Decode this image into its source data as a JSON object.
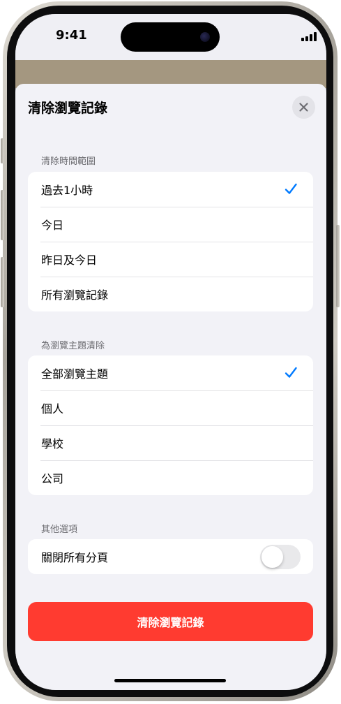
{
  "status_bar": {
    "time": "9:41",
    "battery_level": 0.85
  },
  "sheet": {
    "title": "清除瀏覽記錄",
    "close_icon": "close-icon"
  },
  "time_range": {
    "header": "清除時間範圍",
    "options": [
      {
        "label": "過去1小時",
        "selected": true
      },
      {
        "label": "今日",
        "selected": false
      },
      {
        "label": "昨日及今日",
        "selected": false
      },
      {
        "label": "所有瀏覽記錄",
        "selected": false
      }
    ]
  },
  "profiles": {
    "header": "為瀏覽主題清除",
    "options": [
      {
        "label": "全部瀏覽主題",
        "selected": true
      },
      {
        "label": "個人",
        "selected": false
      },
      {
        "label": "學校",
        "selected": false
      },
      {
        "label": "公司",
        "selected": false
      }
    ]
  },
  "other_options": {
    "header": "其他選項",
    "close_all_tabs": {
      "label": "關閉所有分頁",
      "on": false
    }
  },
  "action_button": {
    "label": "清除瀏覽記錄"
  },
  "colors": {
    "accent": "#007aff",
    "destructive": "#ff3b30",
    "sheet_background": "#f2f2f7"
  }
}
